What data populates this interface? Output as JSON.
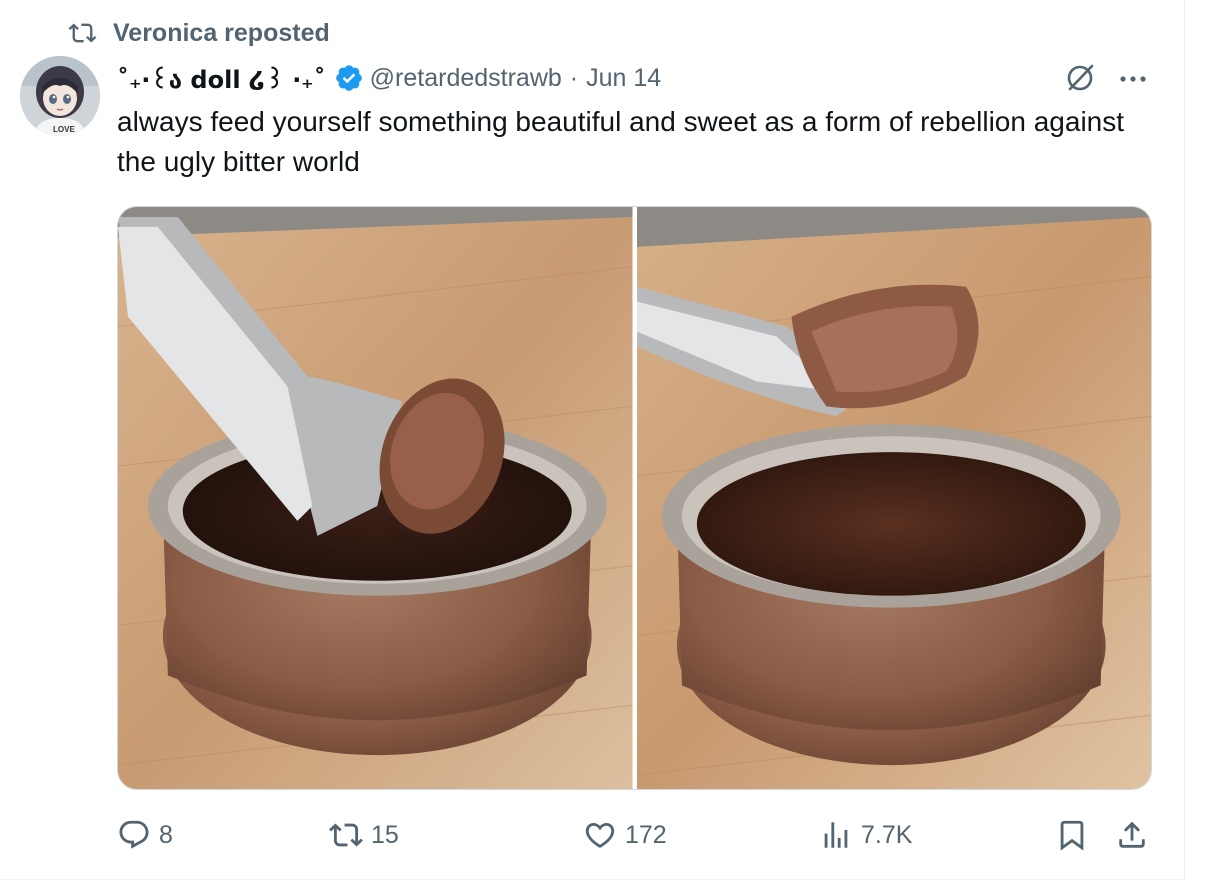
{
  "repost": {
    "label": "Veronica reposted",
    "icon": "repost-icon"
  },
  "author": {
    "display_name": "˚₊‧꒰ა doll ໒꒱ ‧₊˚",
    "verified": true,
    "handle": "@retardedstrawb",
    "separator": "·",
    "date": "Jun 14",
    "avatar_badge_text": "LOVE"
  },
  "tweet": {
    "text": "always feed yourself something beautiful and sweet as a form of rebellion against the ugly bitter world",
    "photos": [
      "chocolate-pudding-photo-1",
      "chocolate-pudding-photo-2"
    ]
  },
  "actions": {
    "replies": "8",
    "reposts": "15",
    "likes": "172",
    "views": "7.7K"
  },
  "colors": {
    "text": "#0f1419",
    "secondary": "#536471",
    "verified": "#1d9bf0",
    "border": "#cfd9de"
  }
}
